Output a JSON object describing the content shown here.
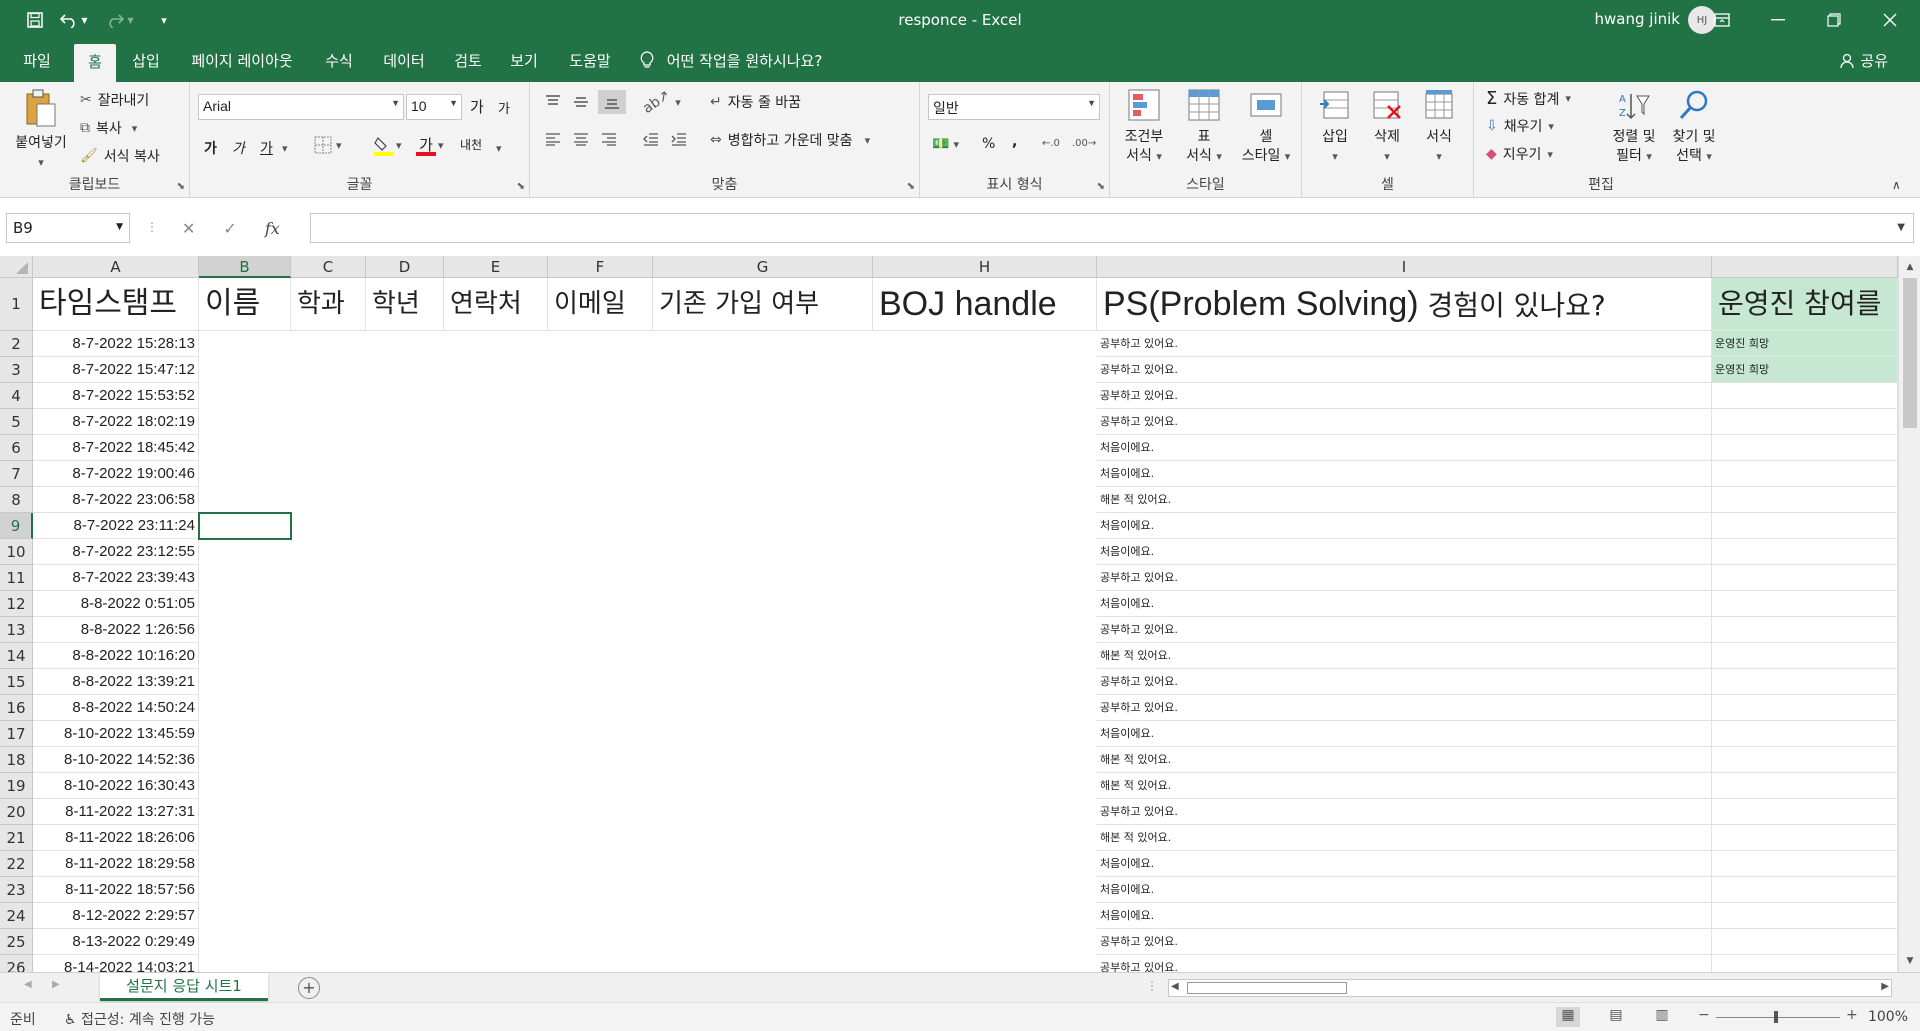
{
  "app": {
    "window_title": "responce  -  Excel",
    "user_name": "hwang jinik",
    "user_initials": "HJ",
    "accent_color": "#217346"
  },
  "menu": {
    "tabs": [
      "파일",
      "홈",
      "삽입",
      "페이지 레이아웃",
      "수식",
      "데이터",
      "검토",
      "보기",
      "도움말"
    ],
    "active_tab": "홈",
    "tell_me": "어떤 작업을 원하시나요?",
    "share": "공유"
  },
  "ribbon": {
    "clipboard": {
      "label": "클립보드",
      "paste": "붙여넣기",
      "cut": "잘라내기",
      "copy": "복사",
      "format_painter": "서식 복사"
    },
    "font": {
      "label": "글꼴",
      "font_name": "Arial",
      "font_size": "10",
      "grow": "가",
      "shrink": "가",
      "bold": "가",
      "italic": "가",
      "underline": "가",
      "phonetic": "내천"
    },
    "alignment": {
      "label": "맞춤",
      "wrap": "자동 줄 바꿈",
      "merge": "병합하고 가운데 맞춤"
    },
    "number": {
      "label": "표시 형식",
      "format": "일반",
      "percent": "%",
      "comma": ","
    },
    "styles": {
      "label": "스타일",
      "conditional_1": "조건부",
      "conditional_2": "서식",
      "table_1": "표",
      "table_2": "서식",
      "cell_1": "셀",
      "cell_2": "스타일"
    },
    "cells": {
      "label": "셀",
      "insert": "삽입",
      "delete": "삭제",
      "format": "서식"
    },
    "editing": {
      "label": "편집",
      "autosum": "자동 합계",
      "fill": "채우기",
      "clear": "지우기",
      "sort_1": "정렬 및",
      "sort_2": "필터",
      "find_1": "찾기 및",
      "find_2": "선택"
    }
  },
  "formula_bar": {
    "name_box": "B9",
    "fx": "fx",
    "content": ""
  },
  "sheet": {
    "columns": [
      "A",
      "B",
      "C",
      "D",
      "E",
      "F",
      "G",
      "H",
      "I"
    ],
    "selected_column": "B",
    "selected_row": "9",
    "headers": {
      "A": "타임스탬프",
      "B": "이름",
      "C": "학과",
      "D": "학년",
      "E": "연락처",
      "F": "이메일",
      "G": "기존 가입 여부",
      "H": "BOJ handle",
      "I_latin": "PS(Problem Solving)",
      "I_korean": " 경험이 있나요?",
      "J": "운영진 참여를"
    },
    "rows": [
      {
        "row": "2",
        "timestamp": "8-7-2022 15:28:13",
        "experience": "공부하고 있어요.",
        "staff": "운영진 희망"
      },
      {
        "row": "3",
        "timestamp": "8-7-2022 15:47:12",
        "experience": "공부하고 있어요.",
        "staff": "운영진 희망"
      },
      {
        "row": "4",
        "timestamp": "8-7-2022 15:53:52",
        "experience": "공부하고 있어요.",
        "staff": ""
      },
      {
        "row": "5",
        "timestamp": "8-7-2022 18:02:19",
        "experience": "공부하고 있어요.",
        "staff": ""
      },
      {
        "row": "6",
        "timestamp": "8-7-2022 18:45:42",
        "experience": "처음이에요.",
        "staff": ""
      },
      {
        "row": "7",
        "timestamp": "8-7-2022 19:00:46",
        "experience": "처음이에요.",
        "staff": ""
      },
      {
        "row": "8",
        "timestamp": "8-7-2022 23:06:58",
        "experience": "해본 적 있어요.",
        "staff": ""
      },
      {
        "row": "9",
        "timestamp": "8-7-2022 23:11:24",
        "experience": "처음이에요.",
        "staff": ""
      },
      {
        "row": "10",
        "timestamp": "8-7-2022 23:12:55",
        "experience": "처음이에요.",
        "staff": ""
      },
      {
        "row": "11",
        "timestamp": "8-7-2022 23:39:43",
        "experience": "공부하고 있어요.",
        "staff": ""
      },
      {
        "row": "12",
        "timestamp": "8-8-2022 0:51:05",
        "experience": "처음이에요.",
        "staff": ""
      },
      {
        "row": "13",
        "timestamp": "8-8-2022 1:26:56",
        "experience": "공부하고 있어요.",
        "staff": ""
      },
      {
        "row": "14",
        "timestamp": "8-8-2022 10:16:20",
        "experience": "해본 적 있어요.",
        "staff": ""
      },
      {
        "row": "15",
        "timestamp": "8-8-2022 13:39:21",
        "experience": "공부하고 있어요.",
        "staff": ""
      },
      {
        "row": "16",
        "timestamp": "8-8-2022 14:50:24",
        "experience": "공부하고 있어요.",
        "staff": ""
      },
      {
        "row": "17",
        "timestamp": "8-10-2022 13:45:59",
        "experience": "처음이에요.",
        "staff": ""
      },
      {
        "row": "18",
        "timestamp": "8-10-2022 14:52:36",
        "experience": "해본 적 있어요.",
        "staff": ""
      },
      {
        "row": "19",
        "timestamp": "8-10-2022 16:30:43",
        "experience": "해본 적 있어요.",
        "staff": ""
      },
      {
        "row": "20",
        "timestamp": "8-11-2022 13:27:31",
        "experience": "공부하고 있어요.",
        "staff": ""
      },
      {
        "row": "21",
        "timestamp": "8-11-2022 18:26:06",
        "experience": "해본 적 있어요.",
        "staff": ""
      },
      {
        "row": "22",
        "timestamp": "8-11-2022 18:29:58",
        "experience": "처음이에요.",
        "staff": ""
      },
      {
        "row": "23",
        "timestamp": "8-11-2022 18:57:56",
        "experience": "처음이에요.",
        "staff": ""
      },
      {
        "row": "24",
        "timestamp": "8-12-2022 2:29:57",
        "experience": "처음이에요.",
        "staff": ""
      },
      {
        "row": "25",
        "timestamp": "8-13-2022 0:29:49",
        "experience": "공부하고 있어요.",
        "staff": ""
      },
      {
        "row": "26",
        "timestamp": "8-14-2022 14:03:21",
        "experience": "공부하고 있어요.",
        "staff": ""
      }
    ],
    "staff_highlight_color": "#c6e7d2",
    "sheet_tab": "설문지 응답 시트1"
  },
  "status": {
    "ready": "준비",
    "accessibility": "접근성: 계속 진행 가능",
    "zoom": "100%"
  }
}
